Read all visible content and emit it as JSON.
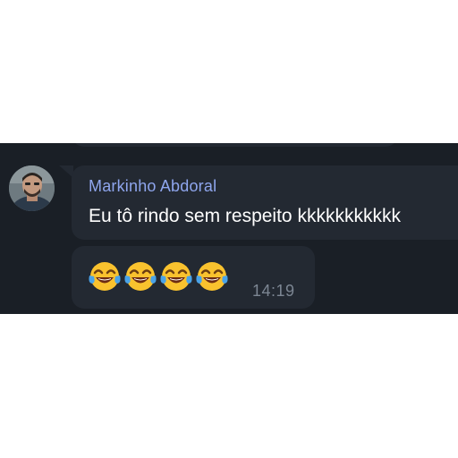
{
  "previous_message": {},
  "message": {
    "avatar_icon": "user-avatar-photo",
    "sender_name": "Markinho Abdoral",
    "text": "Eu tô rindo sem respeito kkkkkkkkkkk",
    "name_color": "#8fa6ee"
  },
  "emoji_message": {
    "emojis": [
      "face-with-tears-of-joy",
      "face-with-tears-of-joy",
      "face-with-tears-of-joy",
      "face-with-tears-of-joy"
    ],
    "time": "14:19"
  },
  "colors": {
    "background": "#1a1f26",
    "bubble": "#232932",
    "text": "#ffffff",
    "timestamp": "#7c8693"
  }
}
